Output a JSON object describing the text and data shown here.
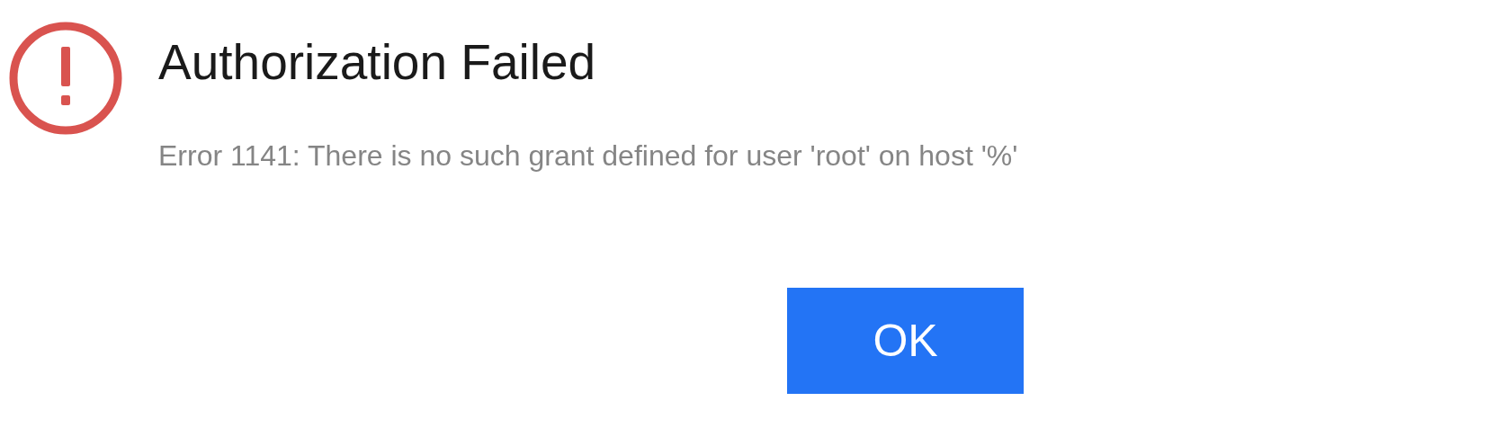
{
  "dialog": {
    "title": "Authorization Failed",
    "message": "Error 1141: There is no such grant defined for user 'root' on host '%'",
    "buttons": [
      {
        "label": "OK",
        "kind": "primary"
      }
    ]
  }
}
